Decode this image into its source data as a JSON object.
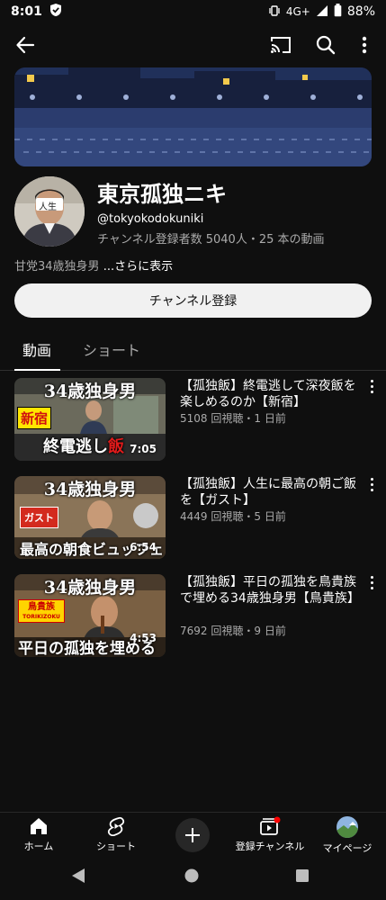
{
  "status_bar": {
    "time": "8:01",
    "network": "4G+",
    "battery": "88%"
  },
  "channel": {
    "title": "東京孤独ニキ",
    "handle": "@tokyokodokuniki",
    "stats": "チャンネル登録者数 5040人・25 本の動画",
    "description": "甘党34歳独身男",
    "more_label": "...さらに表示",
    "avatar_tag": "人生",
    "subscribe_label": "チャンネル登録"
  },
  "tabs": [
    {
      "label": "動画",
      "selected": true
    },
    {
      "label": "ショート",
      "selected": false
    }
  ],
  "videos": [
    {
      "title": "【孤独飯】終電逃して深夜飯を楽しめるのか【新宿】",
      "views": "5108 回視聴",
      "age": "1 日前",
      "duration": "7:05",
      "thumb_top": "34歳独身男",
      "thumb_tag": "新宿",
      "thumb_bottom": "終電逃し",
      "thumb_bottom_accent": "飯"
    },
    {
      "title": "【孤独飯】人生に最高の朝ご飯を【ガスト】",
      "views": "4449 回視聴",
      "age": "5 日前",
      "duration": "6:54",
      "thumb_top": "34歳独身男",
      "thumb_tag": "ガスト",
      "thumb_bottom": "最高の朝食ビュッフェ"
    },
    {
      "title": "【孤独飯】平日の孤独を鳥貴族で埋める34歳独身男【鳥貴族】",
      "views": "7692 回視聴",
      "age": "9 日前",
      "duration": "4:53",
      "thumb_top": "34歳独身男",
      "thumb_tag": "鳥貴族",
      "thumb_tag_sub": "TORIKIZOKU",
      "thumb_bottom": "平日の孤独を埋める"
    }
  ],
  "bottom_nav": [
    {
      "label": "ホーム",
      "icon": "home-icon",
      "active": true
    },
    {
      "label": "ショート",
      "icon": "shorts-icon",
      "active": false
    },
    {
      "label": "",
      "icon": "create-icon",
      "active": false
    },
    {
      "label": "登録チャンネル",
      "icon": "subscriptions-icon",
      "active": false
    },
    {
      "label": "マイページ",
      "icon": "profile-avatar-icon",
      "active": false
    }
  ],
  "colors": {
    "background": "#0f0f0f",
    "subscribe_bg": "#f1f1f1",
    "secondary_text": "#aaaaaa",
    "notification_dot": "#ff0000"
  }
}
